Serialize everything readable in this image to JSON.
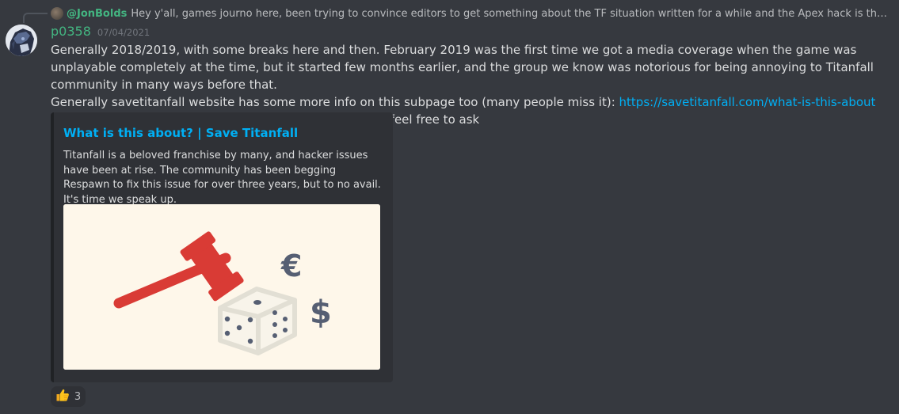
{
  "reply": {
    "author": "@JonBolds",
    "text": "Hey y'all, games journo here, been trying to convince editors to get something about the TF situation written for a while and the Apex hack is the moment I needed. C..."
  },
  "message": {
    "author": "p0358",
    "timestamp": "07/04/2021",
    "paragraph1": "Generally 2018/2019, with some breaks here and then. February 2019 was the first time we got a media coverage when the game was unplayable completely at the time, but it started few months earlier, and the group we know was notorious for being annoying to Titanfall community in many ways before that.",
    "paragraph2_prefix": "Generally savetitanfall website has some more info on this subpage too (many people miss it): ",
    "paragraph2_link": "https://savetitanfall.com/what-is-this-about",
    "paragraph3": "I'm happy to answer any other questions you may have, feel free to ask"
  },
  "embed": {
    "title": "What is this about? | Save Titanfall",
    "description": "Titanfall is a beloved franchise by many, and hacker issues have been at rise. The community has been begging Respawn to fix this issue for over three years, but to no avail. It's time we speak up.",
    "image_symbols": {
      "euro": "€",
      "dollar": "$"
    }
  },
  "reaction": {
    "emoji": "👍",
    "count": "3"
  },
  "colors": {
    "background": "#36393f",
    "author": "#43b581",
    "link": "#00aff4",
    "embed_bg": "#2f3136",
    "image_bg": "#fef7ea",
    "gavel": "#d93b35"
  }
}
